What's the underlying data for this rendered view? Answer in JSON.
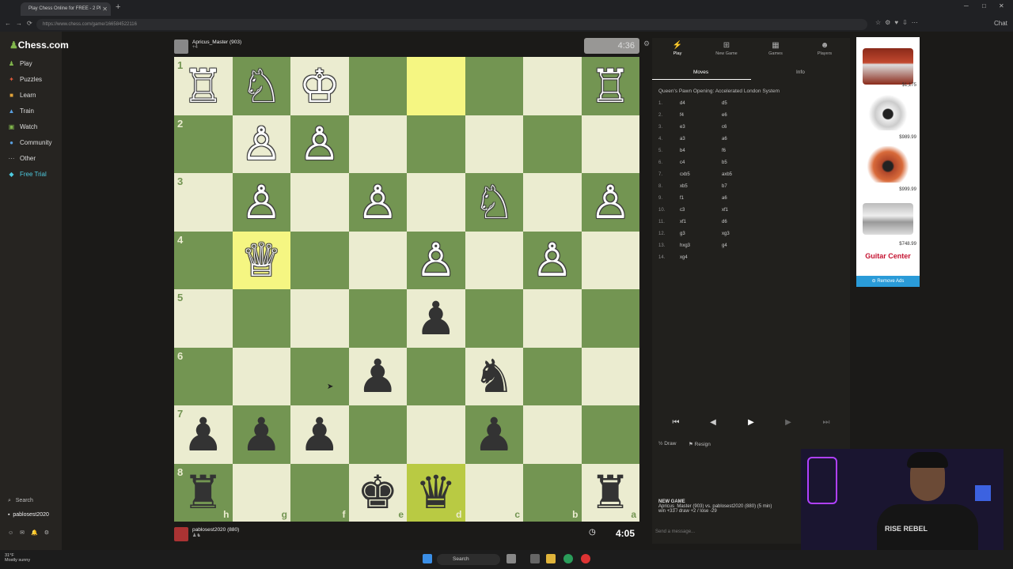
{
  "browser": {
    "tab_title": "Play Chess Online for FREE - 2 Pl",
    "url": "https://www.chess.com/game/166584522116",
    "chat_label": "Chat"
  },
  "sidebar": {
    "logo": "Chess.com",
    "items": [
      {
        "label": "Play",
        "icon": "play-icon",
        "color": "#81b64c"
      },
      {
        "label": "Puzzles",
        "icon": "puzzle-icon",
        "color": "#e05a3a"
      },
      {
        "label": "Learn",
        "icon": "learn-icon",
        "color": "#e0a23a"
      },
      {
        "label": "Train",
        "icon": "train-icon",
        "color": "#5aa0e0"
      },
      {
        "label": "Watch",
        "icon": "watch-icon",
        "color": "#81b64c"
      },
      {
        "label": "Community",
        "icon": "community-icon",
        "color": "#5aa0e0"
      },
      {
        "label": "Other",
        "icon": "more-icon",
        "color": "#aaaaaa"
      },
      {
        "label": "Free Trial",
        "icon": "diamond-icon",
        "color": "#4ecbe0"
      }
    ],
    "search_label": "Search",
    "username": "pablosest2020"
  },
  "top_player": {
    "name": "Apricus_Master (903)",
    "clock": "4:36"
  },
  "bottom_player": {
    "name": "pablosest2020 (880)",
    "clock": "4:05"
  },
  "board": {
    "orientation": "black-bottom",
    "ranks_top_to_bottom": [
      "1",
      "2",
      "3",
      "4",
      "5",
      "6",
      "7",
      "8"
    ],
    "files_left_to_right": [
      "h",
      "g",
      "f",
      "e",
      "d",
      "c",
      "b",
      "a"
    ],
    "highlights": [
      [
        0,
        4
      ],
      [
        3,
        1
      ]
    ],
    "highlight_moves": [
      [
        7,
        4
      ]
    ],
    "grid": [
      [
        "wR",
        "wN",
        "wK",
        "",
        "",
        "",
        "",
        "wR"
      ],
      [
        "",
        "wP",
        "wP",
        "",
        "",
        "",
        "",
        ""
      ],
      [
        "",
        "wP",
        "",
        "wP",
        "",
        "wN",
        "",
        "wP"
      ],
      [
        "",
        "wQ",
        "",
        "",
        "wP",
        "",
        "wP",
        ""
      ],
      [
        "",
        "",
        "",
        "",
        "bP",
        "",
        "",
        ""
      ],
      [
        "",
        "",
        "",
        "bP",
        "",
        "bN",
        "",
        ""
      ],
      [
        "bP",
        "bP",
        "bP",
        "",
        "",
        "bP",
        "",
        ""
      ],
      [
        "bR",
        "",
        "",
        "bK",
        "bQ",
        "",
        "",
        "bR"
      ]
    ]
  },
  "panel": {
    "tabs": [
      "Play",
      "New Game",
      "Games",
      "Players"
    ],
    "subtabs": [
      "Moves",
      "Info"
    ],
    "opening": "Queen's Pawn Opening: Accelerated London System",
    "moves": [
      {
        "n": "1.",
        "w": "d4",
        "b": "d5"
      },
      {
        "n": "2.",
        "w": "f4",
        "b": "e6"
      },
      {
        "n": "3.",
        "w": "e3",
        "b": "c6"
      },
      {
        "n": "4.",
        "w": "a3",
        "b": "a6"
      },
      {
        "n": "5.",
        "w": "b4",
        "b": "f6"
      },
      {
        "n": "6.",
        "w": "c4",
        "b": "b5"
      },
      {
        "n": "7.",
        "w": "cxb5",
        "b": "axb5"
      },
      {
        "n": "8.",
        "w": "xb5",
        "b": "b7"
      },
      {
        "n": "9.",
        "w": "f1",
        "b": "a6"
      },
      {
        "n": "10.",
        "w": "c3",
        "b": "xf1"
      },
      {
        "n": "11.",
        "w": "xf1",
        "b": "d6"
      },
      {
        "n": "12.",
        "w": "g3",
        "b": "xg3"
      },
      {
        "n": "13.",
        "w": "hxg3",
        "b": "g4"
      },
      {
        "n": "14.",
        "w": "xg4",
        "b": ""
      }
    ],
    "draw_label": "Draw",
    "resign_label": "Resign",
    "new_game_title": "NEW GAME",
    "new_game_desc": "Apricus_Master (903) vs. pablosest2020 (880) (5 min)",
    "new_game_stats": "win +33 / draw +2 / lose -29",
    "message_placeholder": "Send a message..."
  },
  "ad": {
    "prices": [
      "$1,175",
      "$989.99",
      "$999.99",
      "$748.99"
    ],
    "brand": "Guitar Center",
    "remove_label": "Remove Ads"
  },
  "webcam": {
    "shirt_text": "RISE REBEL"
  },
  "taskbar": {
    "weather_temp": "31°F",
    "weather_desc": "Mostly sunny",
    "search_label": "Search"
  }
}
